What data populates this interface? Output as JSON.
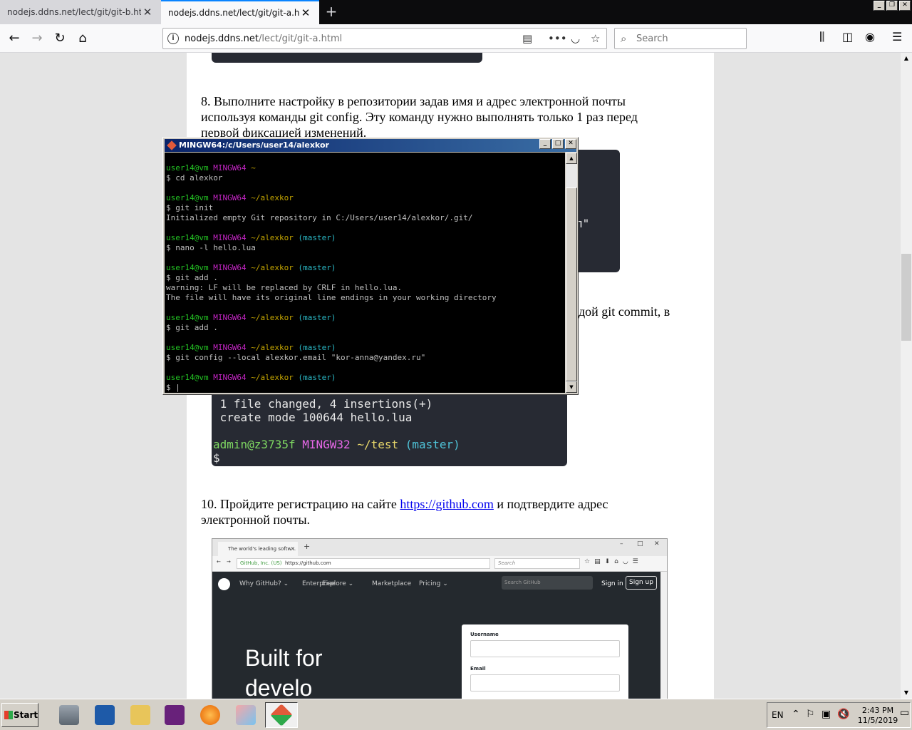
{
  "browser": {
    "tabs": [
      {
        "title": "nodejs.ddns.net/lect/git/git-b.html",
        "active": false
      },
      {
        "title": "nodejs.ddns.net/lect/git/git-a.html",
        "active": true
      }
    ],
    "url_host": "nodejs.ddns.net",
    "url_path": "/lect/git/git-a.html",
    "search_placeholder": "Search",
    "accent_color": "#0a84ff"
  },
  "page": {
    "step8_text": "8. Выполните настройку в репозитории задав имя и адрес электронной почты используя команды git config. Эту команду нужно выполнять только 1 раз перед первой фиксацией изменений.",
    "step9_fragment": "дой git commit, в",
    "step9_image_quote_fragment": "л\"",
    "commit_output": {
      "line1": " 1 file changed, 4 insertions(+)",
      "line2": " create mode 100644 hello.lua",
      "prompt_user": "admin@z3735f",
      "prompt_env": "MINGW32",
      "prompt_path": "~/test",
      "prompt_branch": "(master)",
      "prompt_symbol": "$"
    },
    "step10_prefix": "10. Пройдите регистрацию на сайте ",
    "step10_link": "https://github.com",
    "step10_suffix": " и подтвердите адрес электронной почты."
  },
  "github_shot": {
    "tab_title": "The world's leading softw...",
    "identity": "GitHub, Inc. (US)",
    "url": "https://github.com",
    "search_placeholder": "Search",
    "menu": [
      "Why GitHub? ⌄",
      "Enterprise",
      "Explore ⌄",
      "Marketplace",
      "Pricing ⌄"
    ],
    "search_github": "Search GitHub",
    "signin": "Sign in",
    "signup": "Sign up",
    "hero_line1": "Built for",
    "hero_line2": "develo",
    "form_username": "Username",
    "form_email": "Email"
  },
  "terminal": {
    "title": "MINGW64:/c/Users/user14/alexkor",
    "user": "user14@vm",
    "env": "MINGW64",
    "blocks": [
      {
        "path": "~",
        "branch": "",
        "lines": [
          "$ cd alexkor"
        ]
      },
      {
        "path": "~/alexkor",
        "branch": "",
        "lines": [
          "$ git init",
          "Initialized empty Git repository in C:/Users/user14/alexkor/.git/"
        ]
      },
      {
        "path": "~/alexkor",
        "branch": "(master)",
        "lines": [
          "$ nano -l hello.lua"
        ]
      },
      {
        "path": "~/alexkor",
        "branch": "(master)",
        "lines": [
          "$ git add .",
          "warning: LF will be replaced by CRLF in hello.lua.",
          "The file will have its original line endings in your working directory"
        ]
      },
      {
        "path": "~/alexkor",
        "branch": "(master)",
        "lines": [
          "$ git add ."
        ]
      },
      {
        "path": "~/alexkor",
        "branch": "(master)",
        "lines": [
          "$ git config --local alexkor.email \"kor-anna@yandex.ru\""
        ]
      },
      {
        "path": "~/alexkor",
        "branch": "(master)",
        "lines": [
          "$ |"
        ]
      }
    ]
  },
  "taskbar": {
    "start_label": "Start",
    "language": "EN",
    "time": "2:43 PM",
    "date": "11/5/2019"
  }
}
